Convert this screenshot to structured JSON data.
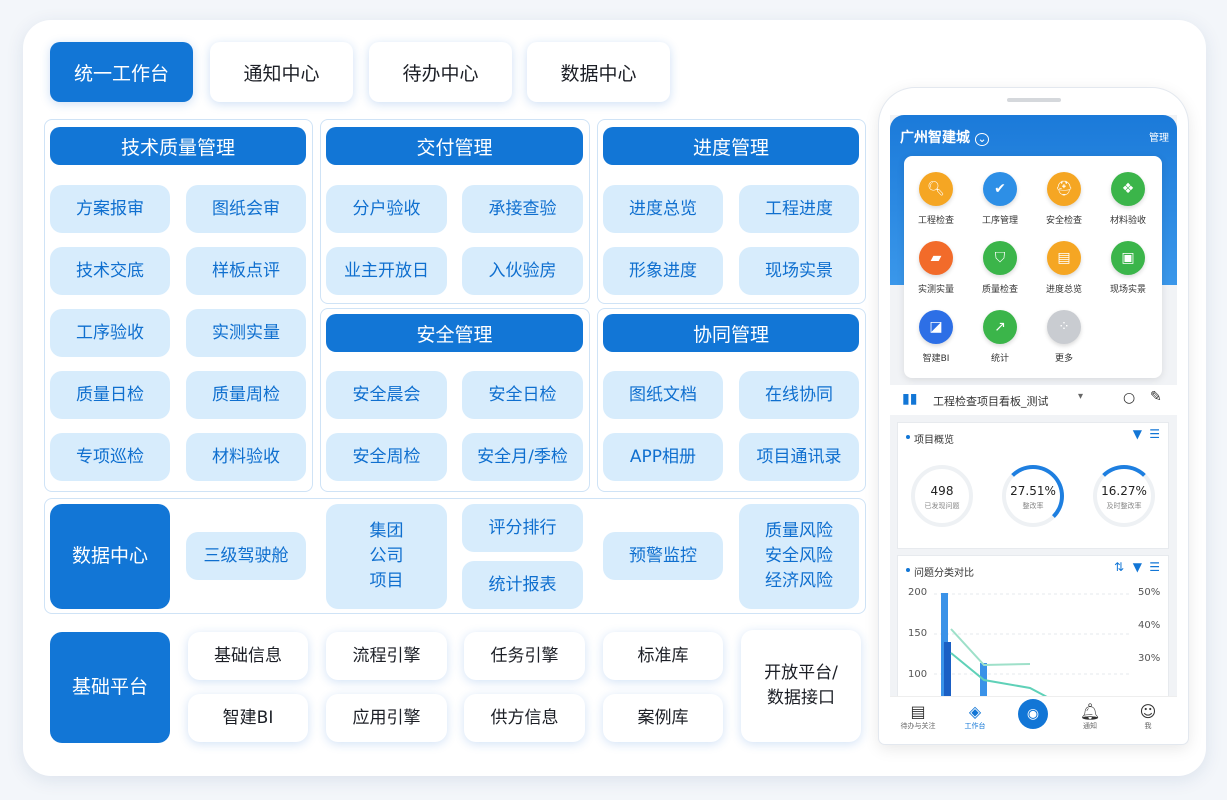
{
  "tabs": [
    "统一工作台",
    "通知中心",
    "待办中心",
    "数据中心"
  ],
  "sections": {
    "tech_quality": {
      "title": "技术质量管理",
      "items": [
        "方案报审",
        "图纸会审",
        "技术交底",
        "样板点评",
        "工序验收",
        "实测实量",
        "质量日检",
        "质量周检",
        "专项巡检",
        "材料验收"
      ]
    },
    "delivery": {
      "title": "交付管理",
      "items": [
        "分户验收",
        "承接查验",
        "业主开放日",
        "入伙验房"
      ]
    },
    "progress": {
      "title": "进度管理",
      "items": [
        "进度总览",
        "工程进度",
        "形象进度",
        "现场实景"
      ]
    },
    "safety": {
      "title": "安全管理",
      "items": [
        "安全晨会",
        "安全日检",
        "安全周检",
        "安全月/季检"
      ]
    },
    "collab": {
      "title": "协同管理",
      "items": [
        "图纸文档",
        "在线协同",
        "APP相册",
        "项目通讯录"
      ]
    },
    "data_center": {
      "title": "数据中心",
      "cockpit": "三级驾驶舱",
      "levels": [
        "集团",
        "公司",
        "项目"
      ],
      "ranking": "评分排行",
      "report": "统计报表",
      "warning": "预警监控",
      "risks": [
        "质量风险",
        "安全风险",
        "经济风险"
      ]
    },
    "base_platform": {
      "title": "基础平台",
      "items": [
        "基础信息",
        "流程引擎",
        "任务引擎",
        "标准库",
        "智建BI",
        "应用引擎",
        "供方信息",
        "案例库"
      ],
      "open": [
        "开放平台/",
        "数据接口"
      ]
    }
  },
  "phone": {
    "city": "广州智建城",
    "manage": "管理",
    "apps": [
      {
        "label": "工程检查",
        "icon": "search-icon",
        "color": "#f5a623"
      },
      {
        "label": "工序管理",
        "icon": "check-icon",
        "color": "#2d8fe6"
      },
      {
        "label": "安全检查",
        "icon": "helmet-icon",
        "color": "#f5a623"
      },
      {
        "label": "材料验收",
        "icon": "cubes-icon",
        "color": "#3bb54a"
      },
      {
        "label": "实测实量",
        "icon": "ruler-icon",
        "color": "#f26b2a"
      },
      {
        "label": "质量检查",
        "icon": "shield-icon",
        "color": "#3bb54a"
      },
      {
        "label": "进度总览",
        "icon": "book-icon",
        "color": "#f5a623"
      },
      {
        "label": "现场实景",
        "icon": "image-icon",
        "color": "#3bb54a"
      },
      {
        "label": "智建BI",
        "icon": "chart-icon",
        "color": "#2d6fe6"
      },
      {
        "label": "统计",
        "icon": "trend-icon",
        "color": "#3bb54a"
      },
      {
        "label": "更多",
        "icon": "grid-icon",
        "color": "#c9ccd1"
      }
    ],
    "board_title": "工程检查项目看板_测试",
    "overview": {
      "title": "项目概览",
      "stats": [
        {
          "value": "498",
          "label": "已发现问题",
          "progress": 0
        },
        {
          "value": "27.51%",
          "label": "整改率",
          "progress": 27.51
        },
        {
          "value": "16.27%",
          "label": "及时整改率",
          "progress": 16.27
        }
      ]
    },
    "compare": {
      "title": "问题分类对比",
      "y_left": [
        "200",
        "150",
        "100"
      ],
      "y_right": [
        "50%",
        "40%",
        "30%"
      ]
    },
    "tabbar": [
      "待办与关注",
      "工作台",
      "",
      "通知",
      "我"
    ]
  }
}
